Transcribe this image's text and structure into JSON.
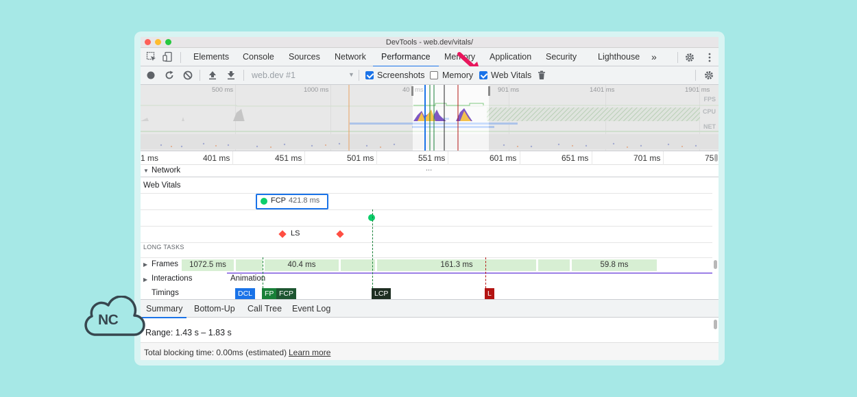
{
  "window": {
    "title": "DevTools - web.dev/vitals/"
  },
  "main_tabs": [
    "Elements",
    "Console",
    "Sources",
    "Network",
    "Performance",
    "Memory",
    "Application",
    "Security",
    "Lighthouse"
  ],
  "main_tabs_overflow": "»",
  "toolbar": {
    "recording_select": "web.dev #1",
    "screenshots_label": "Screenshots",
    "screenshots_checked": true,
    "memory_label": "Memory",
    "memory_checked": false,
    "webvitals_label": "Web Vitals",
    "webvitals_checked": true
  },
  "overview": {
    "ticks": [
      "500 ms",
      "1000 ms",
      "40",
      "ms",
      "901 ms",
      "1401 ms",
      "1901 ms"
    ],
    "tracks": [
      "FPS",
      "CPU",
      "NET"
    ]
  },
  "ruler": {
    "ticks": [
      "1 ms",
      "401 ms",
      "451 ms",
      "501 ms",
      "551 ms",
      "601 ms",
      "651 ms",
      "701 ms",
      "75"
    ]
  },
  "network": {
    "label": "Network",
    "more": "..."
  },
  "web_vitals": {
    "heading": "Web Vitals",
    "fcp_label": "FCP",
    "fcp_value": "421.8 ms",
    "ls_label": "LS"
  },
  "long_tasks": "LONG TASKS",
  "frames": {
    "label": "Frames",
    "items": [
      "1072.5 ms",
      "40.4 ms",
      "161.3 ms",
      "59.8 ms"
    ]
  },
  "interactions": {
    "label": "Interactions",
    "animation": "Animation"
  },
  "timings": {
    "label": "Timings",
    "badges": [
      "DCL",
      "FP",
      "FCP",
      "LCP",
      "L"
    ],
    "colors": {
      "DCL": "#1a73e8",
      "FP": "#188038",
      "FCP": "#1e5631",
      "LCP": "#1e2e22",
      "L": "#b31412"
    }
  },
  "bottom_tabs": [
    "Summary",
    "Bottom-Up",
    "Call Tree",
    "Event Log"
  ],
  "summary": {
    "range": "Range: 1.43 s – 1.83 s"
  },
  "footer": {
    "text": "Total blocking time: 0.00ms (estimated)",
    "link": "Learn more"
  },
  "logo": {
    "text": "NC"
  },
  "colors": {
    "background": "#a6e8e6",
    "accent": "#1a73e8",
    "arrow": "#e8175d"
  }
}
